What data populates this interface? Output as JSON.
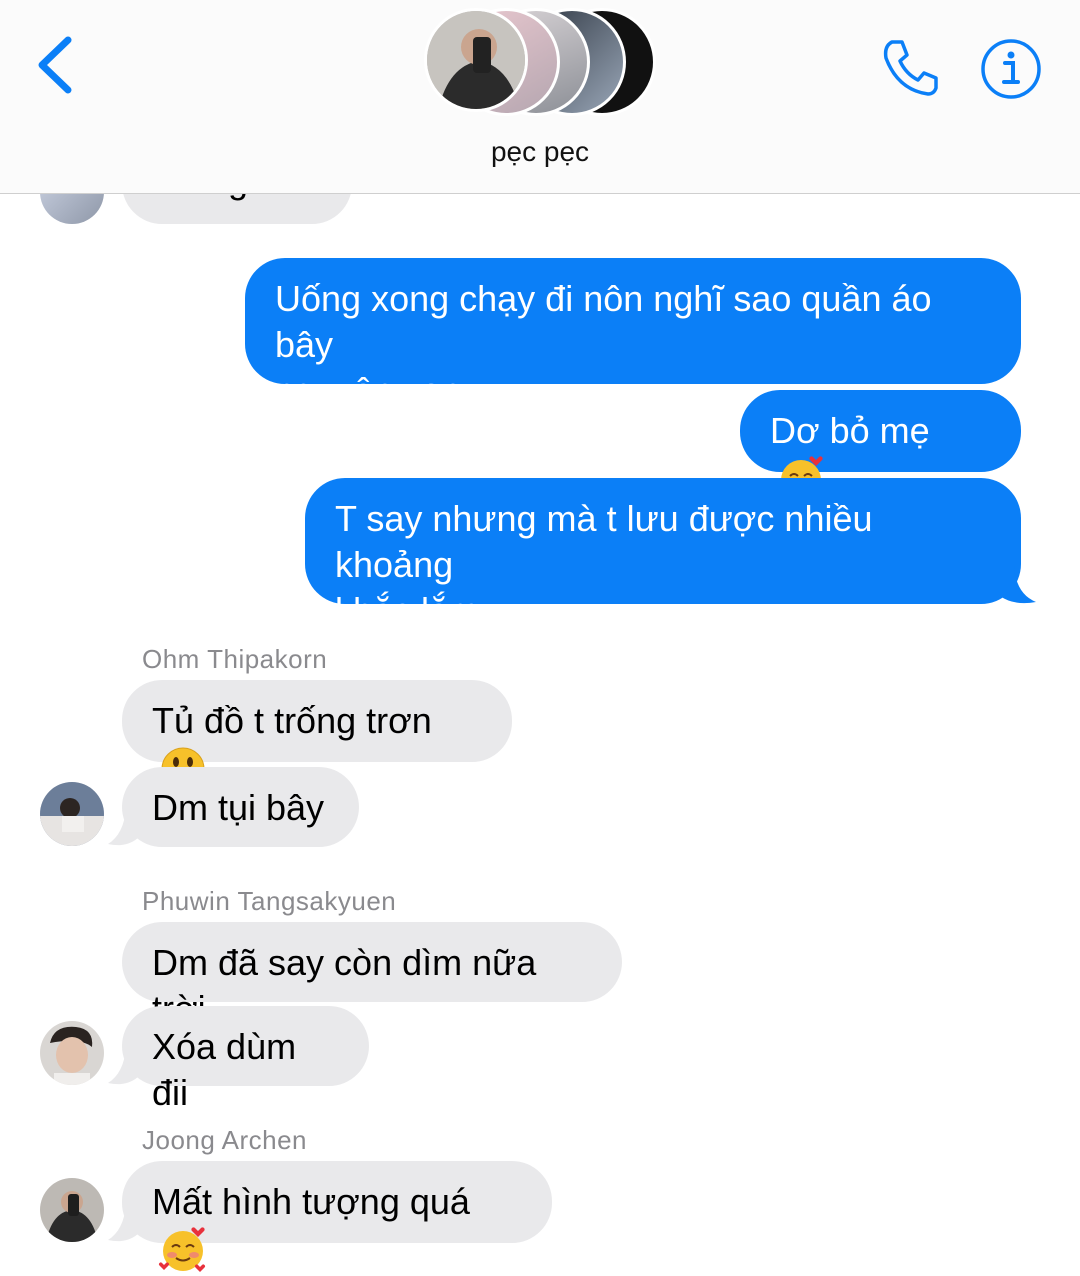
{
  "header": {
    "group_name": "pẹc pẹc",
    "back_icon": "chevron-left-icon",
    "call_icon": "phone-icon",
    "info_icon": "info-icon",
    "accent": "#0b7ff7"
  },
  "messages": {
    "partial_top": "Giống t đó",
    "sent": [
      {
        "line1": "Uống xong chạy đi nôn nghĩ sao quần áo bây",
        "line2": "nguyên vẹn"
      },
      {
        "text": "Dơ bỏ mẹ",
        "emoji": "smiling-face-with-hearts"
      },
      {
        "line1": "T say nhưng mà t lưu được nhiều khoảng",
        "line2": "khắc lắm"
      }
    ],
    "groups": [
      {
        "sender": "Ohm Thipakorn",
        "msg1": "Tủ đồ t trống trơn",
        "msg1_emoji": "grinning-face",
        "msg2": "Dm tụi bây"
      },
      {
        "sender": "Phuwin Tangsakyuen",
        "msg1": "Dm đã say còn dìm nữa trời",
        "msg2": "Xóa dùm đii"
      },
      {
        "sender": "Joong Archen",
        "msg1": "Mất hình tượng quá",
        "msg1_emoji": "smiling-face-with-hearts"
      }
    ]
  },
  "colors": {
    "sent_bubble": "#0b7ff7",
    "received_bubble": "#e9e9eb",
    "sender_name": "#8a8a8e"
  }
}
